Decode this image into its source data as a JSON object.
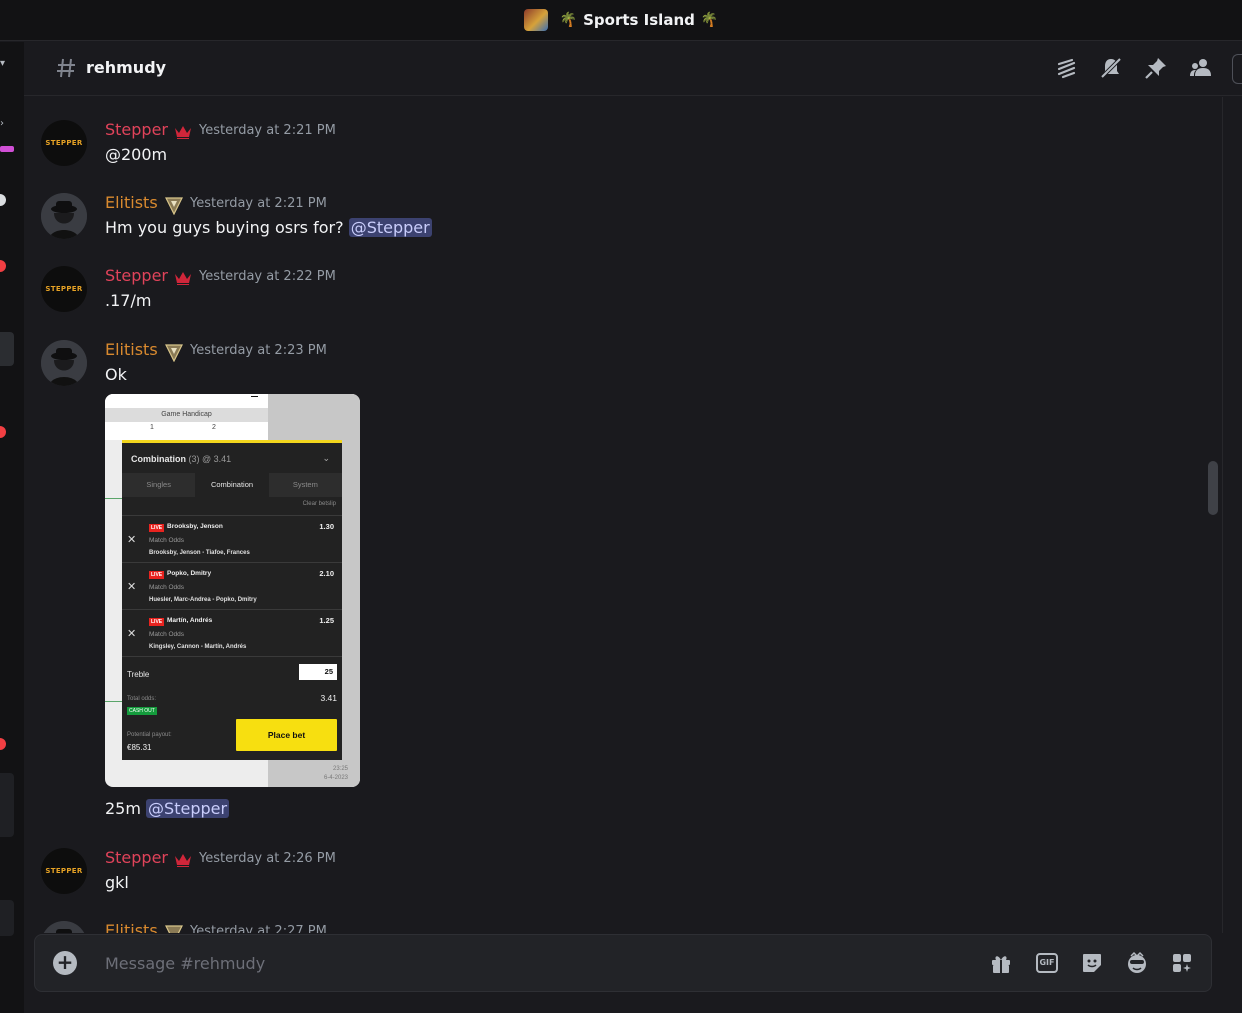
{
  "server": {
    "title": "Sports Island"
  },
  "channel": {
    "name": "rehmudy"
  },
  "messages": [
    {
      "author": "Stepper",
      "timestamp": "Yesterday at 2:21 PM",
      "text": "@200m",
      "mention": ""
    },
    {
      "author": "Elitists",
      "timestamp": "Yesterday at 2:21 PM",
      "text": "Hm you guys buying osrs for?",
      "mention": "@Stepper"
    },
    {
      "author": "Stepper",
      "timestamp": "Yesterday at 2:22 PM",
      "text": ".17/m",
      "mention": ""
    },
    {
      "author": "Elitists",
      "timestamp": "Yesterday at 2:23 PM",
      "text": "Ok",
      "mention": ""
    },
    {
      "author": "",
      "timestamp": "",
      "text": "25m",
      "mention": "@Stepper"
    },
    {
      "author": "Stepper",
      "timestamp": "Yesterday at 2:26 PM",
      "text": "gkl",
      "mention": ""
    },
    {
      "author": "Elitists",
      "timestamp": "Yesterday at 2:27 PM",
      "text": "",
      "mention": ""
    }
  ],
  "avatar_text": {
    "stepper": "STEPPER"
  },
  "attachment": {
    "background_header": "Game Handicap",
    "background_cols": [
      "1",
      "2"
    ],
    "betslip": {
      "title": "Combination",
      "title_meta": "(3) @ 3.41",
      "tabs": [
        "Singles",
        "Combination",
        "System"
      ],
      "clear_label": "Clear betslip",
      "live_label": "LIVE",
      "legs": [
        {
          "selection": "Brooksby, Jenson",
          "market": "Match Odds",
          "event": "Brooksby, Jenson - Tiafoe, Frances",
          "odds": "1.30"
        },
        {
          "selection": "Popko, Dmitry",
          "market": "Match Odds",
          "event": "Huesler, Marc-Andrea - Popko, Dmitry",
          "odds": "2.10"
        },
        {
          "selection": "Martín, Andrés",
          "market": "Match Odds",
          "event": "Kingsley, Cannon - Martín, Andrés",
          "odds": "1.25"
        }
      ],
      "bet_type": "Treble",
      "stake": "25",
      "total_odds_label": "Total odds:",
      "total_odds": "3.41",
      "cashout_label": "CASH OUT",
      "payout_label": "Potential payout:",
      "payout": "€85.31",
      "place_bet_label": "Place bet"
    },
    "screenshot_time": "23:25",
    "screenshot_date": "6-4-2023"
  },
  "composer": {
    "placeholder": "Message #rehmudy",
    "gif_label": "GIF"
  },
  "colors": {
    "stepper": "#e0435a",
    "elitists": "#d98a2f",
    "mention_bg": "#3c4270",
    "place_bet": "#f7df10"
  },
  "icons": {
    "header": [
      "threads-icon",
      "mute-bell-icon",
      "pin-icon",
      "members-icon"
    ],
    "composer": [
      "gift-icon",
      "gif-icon",
      "sticker-icon",
      "emoji-icon",
      "apps-icon"
    ]
  }
}
